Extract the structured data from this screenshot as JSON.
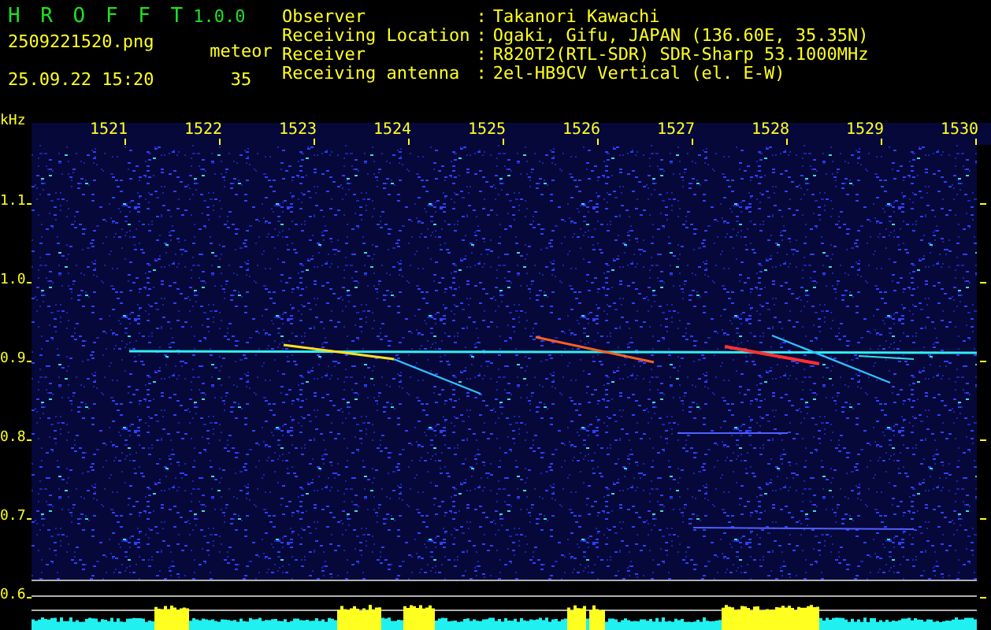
{
  "app": {
    "title": "H R O F F T",
    "version": "1.0.0"
  },
  "file": {
    "name": "2509221520.png",
    "timestamp": "25.09.22 15:20"
  },
  "detection": {
    "label": "meteor",
    "count": "35"
  },
  "station_info": [
    {
      "label": "Observer",
      "separator": ":",
      "value": "Takanori Kawachi"
    },
    {
      "label": "Receiving Location",
      "separator": ":",
      "value": "Ogaki, Gifu, JAPAN (136.60E, 35.35N)"
    },
    {
      "label": "Receiver",
      "separator": ":",
      "value": "R820T2(RTL-SDR) SDR-Sharp 53.1000MHz"
    },
    {
      "label": "Receiving antenna",
      "separator": ":",
      "value": "2el-HB9CV Vertical (el. E-W)"
    }
  ],
  "spectrogram": {
    "y_unit": "kHz",
    "x_ticks": [
      "1521",
      "1522",
      "1523",
      "1524",
      "1525",
      "1526",
      "1527",
      "1528",
      "1529",
      "1530"
    ],
    "y_ticks": [
      "1.1",
      "1.0",
      "0.9",
      "0.8",
      "0.7",
      "0.6"
    ]
  }
}
